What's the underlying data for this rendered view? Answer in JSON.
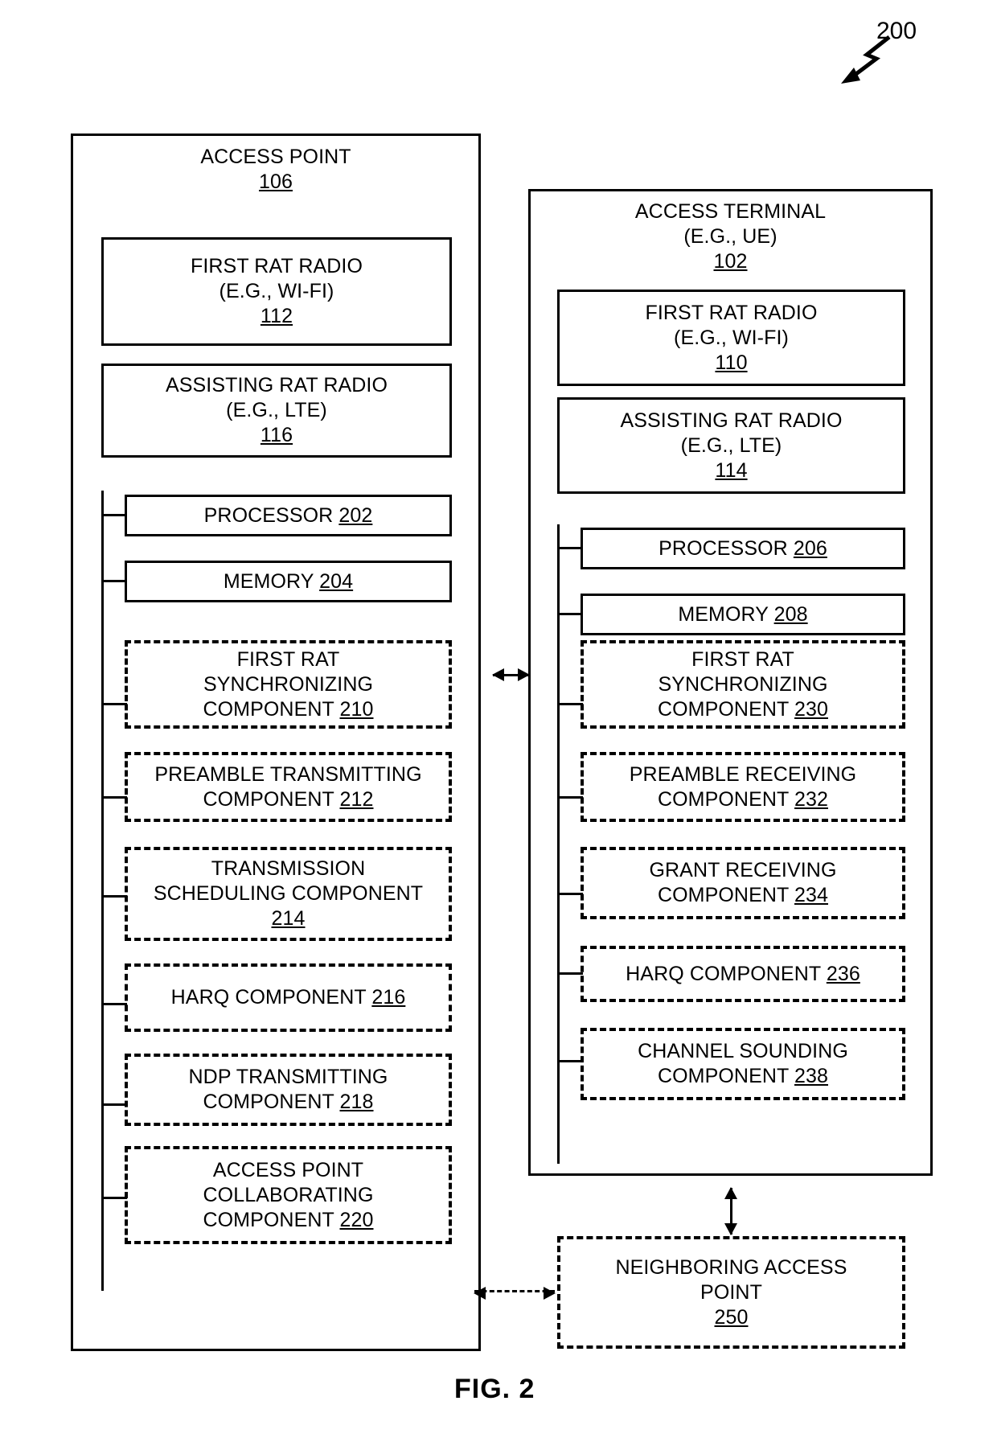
{
  "figure": {
    "label": "FIG. 2",
    "callout": "200"
  },
  "access_point": {
    "title": "ACCESS POINT",
    "ref": "106",
    "blocks": [
      {
        "lines": [
          "FIRST RAT RADIO",
          "(E.G., WI-FI)"
        ],
        "ref": "112",
        "style": "solid"
      },
      {
        "lines": [
          "ASSISTING RAT RADIO",
          "(E.G., LTE)"
        ],
        "ref": "116",
        "style": "solid"
      }
    ],
    "bus_blocks": [
      {
        "lines": [
          "PROCESSOR"
        ],
        "ref": "202",
        "style": "solid",
        "inline": true
      },
      {
        "lines": [
          "MEMORY"
        ],
        "ref": "204",
        "style": "solid",
        "inline": true
      },
      {
        "lines": [
          "FIRST RAT",
          "SYNCHRONIZING",
          "COMPONENT"
        ],
        "ref": "210",
        "style": "dashed",
        "inline": true
      },
      {
        "lines": [
          "PREAMBLE TRANSMITTING",
          "COMPONENT"
        ],
        "ref": "212",
        "style": "dashed",
        "inline": true
      },
      {
        "lines": [
          "TRANSMISSION",
          "SCHEDULING COMPONENT"
        ],
        "ref": "214",
        "style": "dashed",
        "inline": false
      },
      {
        "lines": [
          "HARQ COMPONENT"
        ],
        "ref": "216",
        "style": "dashed",
        "inline": true
      },
      {
        "lines": [
          "NDP TRANSMITTING",
          "COMPONENT"
        ],
        "ref": "218",
        "style": "dashed",
        "inline": true
      },
      {
        "lines": [
          "ACCESS POINT",
          "COLLABORATING",
          "COMPONENT"
        ],
        "ref": "220",
        "style": "dashed",
        "inline": true
      }
    ]
  },
  "access_terminal": {
    "title": "ACCESS TERMINAL",
    "subtitle": "(E.G., UE)",
    "ref": "102",
    "blocks": [
      {
        "lines": [
          "FIRST RAT RADIO",
          "(E.G., WI-FI)"
        ],
        "ref": "110",
        "style": "solid"
      },
      {
        "lines": [
          "ASSISTING RAT RADIO",
          "(E.G., LTE)"
        ],
        "ref": "114",
        "style": "solid"
      }
    ],
    "bus_blocks": [
      {
        "lines": [
          "PROCESSOR"
        ],
        "ref": "206",
        "style": "solid",
        "inline": true
      },
      {
        "lines": [
          "MEMORY"
        ],
        "ref": "208",
        "style": "solid",
        "inline": true
      },
      {
        "lines": [
          "FIRST RAT",
          "SYNCHRONIZING",
          "COMPONENT"
        ],
        "ref": "230",
        "style": "dashed",
        "inline": true
      },
      {
        "lines": [
          "PREAMBLE RECEIVING",
          "COMPONENT"
        ],
        "ref": "232",
        "style": "dashed",
        "inline": true
      },
      {
        "lines": [
          "GRANT RECEIVING",
          "COMPONENT"
        ],
        "ref": "234",
        "style": "dashed",
        "inline": true
      },
      {
        "lines": [
          "HARQ COMPONENT"
        ],
        "ref": "236",
        "style": "dashed",
        "inline": true
      },
      {
        "lines": [
          "CHANNEL SOUNDING",
          "COMPONENT"
        ],
        "ref": "238",
        "style": "dashed",
        "inline": true
      }
    ]
  },
  "neighboring_access_point": {
    "lines": [
      "NEIGHBORING ACCESS",
      "POINT"
    ],
    "ref": "250"
  }
}
